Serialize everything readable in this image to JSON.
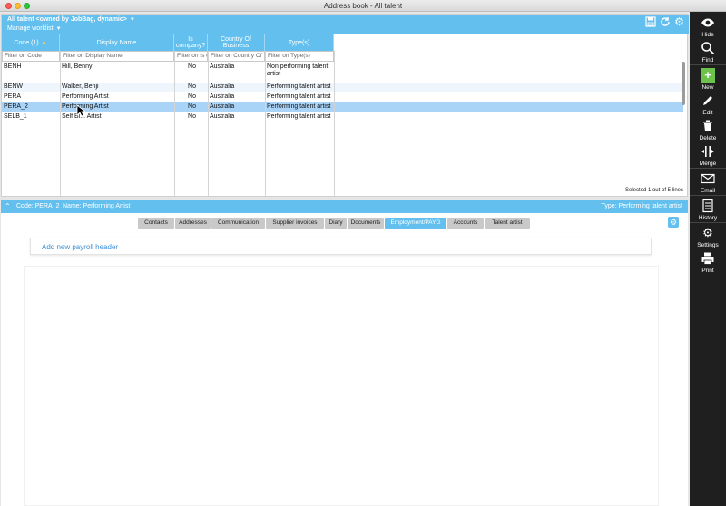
{
  "window": {
    "title": "Address book - All talent"
  },
  "upper_header": {
    "worklist_title": "All talent <owned by JobBag, dynamic>",
    "manage_worklist": "Manage worklist",
    "icons": [
      "save-icon",
      "refresh-icon",
      "gear-icon"
    ]
  },
  "grid": {
    "columns": [
      {
        "label": "Code (1)",
        "filter": "Filter on Code"
      },
      {
        "label": "Display Name",
        "filter": "Filter on Display Name"
      },
      {
        "label": "Is company?",
        "filter": "Filter on Is c"
      },
      {
        "label": "Country Of Business",
        "filter": "Filter on Country Of B"
      },
      {
        "label": "Type(s)",
        "filter": "Filter on Type(s)"
      }
    ],
    "rows": [
      {
        "code": "BENH",
        "display_name": "Hill, Benny",
        "is_company": "No",
        "country": "Australia",
        "types": "Non performing talent artist"
      },
      {
        "code": "BENW",
        "display_name": "Walker, Benji",
        "is_company": "No",
        "country": "Australia",
        "types": "Performing talent artist"
      },
      {
        "code": "PERA",
        "display_name": "Performing Artist",
        "is_company": "No",
        "country": "Australia",
        "types": "Performing talent artist"
      },
      {
        "code": "PERA_2",
        "display_name": "Performing Artist",
        "is_company": "No",
        "country": "Australia",
        "types": "Performing talent artist"
      },
      {
        "code": "SELB_1",
        "display_name": "Self Bi... Artist",
        "is_company": "No",
        "country": "Australia",
        "types": "Performing talent artist"
      }
    ],
    "selected_info": "Selected 1 out of 5 lines"
  },
  "detail": {
    "code": "Code: PERA_2",
    "name": "Name: Performing Artist",
    "type": "Type: Performing talent artist",
    "tabs": [
      "Contacts",
      "Addresses",
      "Communication",
      "Supplier invoices",
      "Diary",
      "Documents",
      "Employment/PAYG",
      "Accounts",
      "Talent artist"
    ],
    "active_tab": "Employment/PAYG",
    "add_payroll_header": "Add new payroll header"
  },
  "toolbar": {
    "items": [
      {
        "label": "Hide",
        "icon": "eye-icon"
      },
      {
        "label": "Find",
        "icon": "search-icon"
      },
      {
        "label": "New",
        "icon": "plus-icon"
      },
      {
        "label": "Edit",
        "icon": "pencil-icon"
      },
      {
        "label": "Delete",
        "icon": "trash-icon"
      },
      {
        "label": "Merge",
        "icon": "merge-icon"
      },
      {
        "label": "Email",
        "icon": "envelope-icon"
      },
      {
        "label": "History",
        "icon": "document-icon"
      },
      {
        "label": "Settings",
        "icon": "gear-icon"
      },
      {
        "label": "Print",
        "icon": "printer-icon"
      }
    ]
  },
  "colors": {
    "accent": "#63c0ee",
    "selected_row": "#a9d3f7",
    "toolbar_bg": "#1f1f1f",
    "new_button": "#6cc24a"
  }
}
